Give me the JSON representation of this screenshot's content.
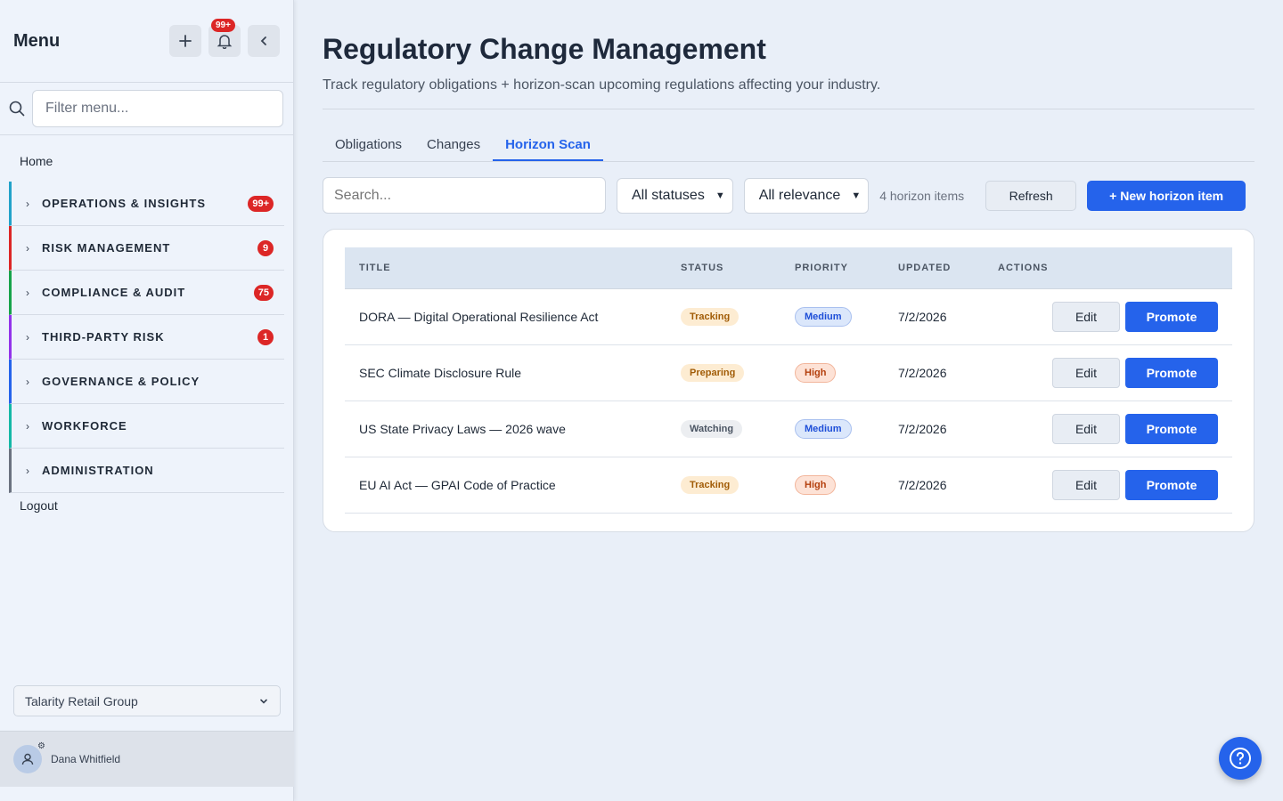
{
  "sidebar": {
    "title": "Menu",
    "notification_count": "99+",
    "filter_placeholder": "Filter menu...",
    "home": "Home",
    "groups": [
      {
        "label": "OPERATIONS & INSIGHTS",
        "badge": "99+",
        "color": "#22a2c9"
      },
      {
        "label": "RISK MANAGEMENT",
        "badge": "9",
        "color": "#dc2626"
      },
      {
        "label": "COMPLIANCE & AUDIT",
        "badge": "75",
        "color": "#16a34a"
      },
      {
        "label": "THIRD-PARTY RISK",
        "badge": "1",
        "color": "#9333ea"
      },
      {
        "label": "GOVERNANCE & POLICY",
        "badge": "",
        "color": "#2563eb"
      },
      {
        "label": "WORKFORCE",
        "badge": "",
        "color": "#14b8a6"
      },
      {
        "label": "ADMINISTRATION",
        "badge": "",
        "color": "#6b7280"
      }
    ],
    "logout": "Logout",
    "org": "Talarity Retail Group",
    "user": "Dana Whitfield"
  },
  "page": {
    "title": "Regulatory Change Management",
    "subtitle": "Track regulatory obligations + horizon-scan upcoming regulations affecting your industry."
  },
  "tabs": [
    "Obligations",
    "Changes",
    "Horizon Scan"
  ],
  "active_tab": "Horizon Scan",
  "toolbar": {
    "search_placeholder": "Search...",
    "status_filter": "All statuses",
    "relevance_filter": "All relevance",
    "count": "4 horizon items",
    "refresh": "Refresh",
    "new_item": "+ New horizon item"
  },
  "table": {
    "headers": {
      "title": "TITLE",
      "status": "STATUS",
      "priority": "PRIORITY",
      "updated": "UPDATED",
      "actions": "ACTIONS"
    },
    "rows": [
      {
        "title": "DORA — Digital Operational Resilience Act",
        "status": "Tracking",
        "priority": "Medium",
        "updated": "7/2/2026"
      },
      {
        "title": "SEC Climate Disclosure Rule",
        "status": "Preparing",
        "priority": "High",
        "updated": "7/2/2026"
      },
      {
        "title": "US State Privacy Laws — 2026 wave",
        "status": "Watching",
        "priority": "Medium",
        "updated": "7/2/2026"
      },
      {
        "title": "EU AI Act — GPAI Code of Practice",
        "status": "Tracking",
        "priority": "High",
        "updated": "7/2/2026"
      }
    ],
    "edit_label": "Edit",
    "promote_label": "Promote"
  },
  "colors": {
    "accent": "#2563eb",
    "danger": "#dc2626"
  }
}
